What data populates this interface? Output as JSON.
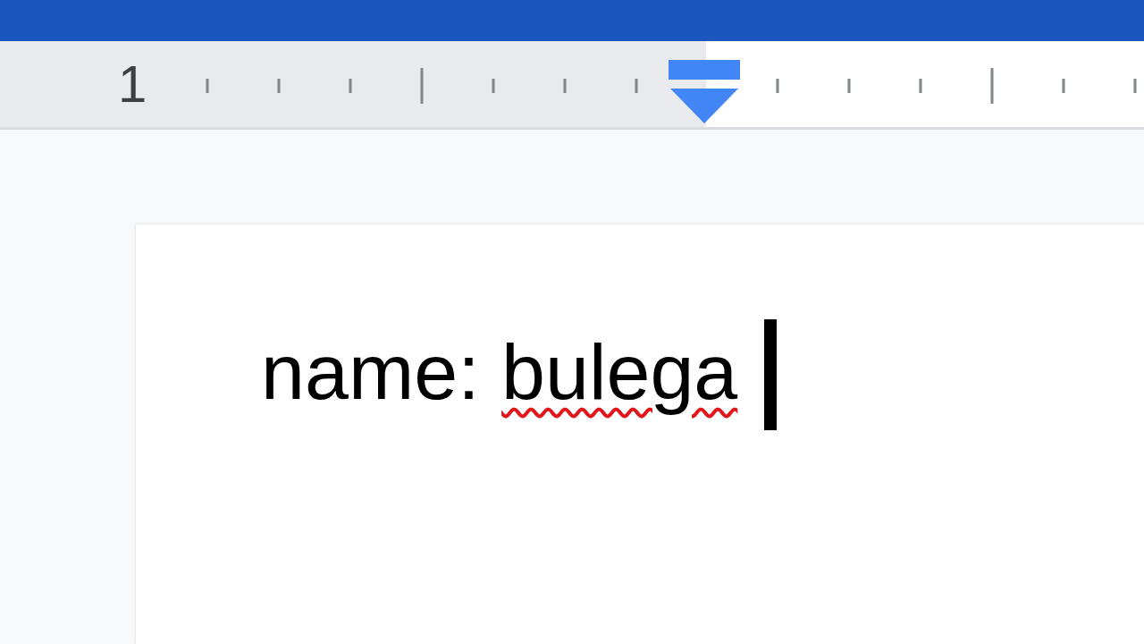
{
  "ruler": {
    "number": "1"
  },
  "document": {
    "text_parts": [
      {
        "text": "name: ",
        "misspelled": false
      },
      {
        "text": "bulega",
        "misspelled": true
      }
    ],
    "cursor": true
  }
}
